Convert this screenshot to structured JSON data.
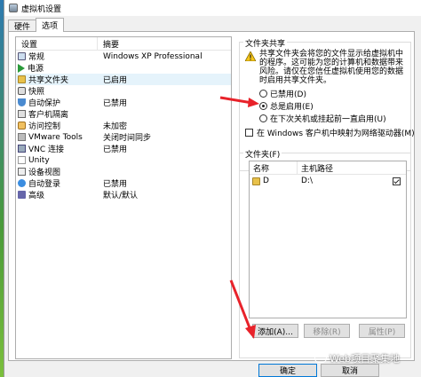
{
  "window": {
    "title": "虚拟机设置"
  },
  "tabs": [
    {
      "label": "硬件"
    },
    {
      "label": "选项"
    }
  ],
  "settings_list": {
    "headers": {
      "setting": "设置",
      "summary": "摘要"
    },
    "rows": [
      {
        "icon": "display-icon",
        "setting": "常规",
        "summary": "Windows XP Professional"
      },
      {
        "icon": "power-icon",
        "setting": "电源",
        "summary": ""
      },
      {
        "icon": "shared-folder-icon",
        "setting": "共享文件夹",
        "summary": "已启用"
      },
      {
        "icon": "snapshot-icon",
        "setting": "快照",
        "summary": ""
      },
      {
        "icon": "shield-icon",
        "setting": "自动保护",
        "summary": "已禁用"
      },
      {
        "icon": "guest-isolation-icon",
        "setting": "客户机隔离",
        "summary": ""
      },
      {
        "icon": "access-control-icon",
        "setting": "访问控制",
        "summary": "未加密"
      },
      {
        "icon": "vmware-tools-icon",
        "setting": "VMware Tools",
        "summary": "关闭时间同步"
      },
      {
        "icon": "vnc-icon",
        "setting": "VNC 连接",
        "summary": "已禁用"
      },
      {
        "icon": "unity-icon",
        "setting": "Unity",
        "summary": ""
      },
      {
        "icon": "appliance-view-icon",
        "setting": "设备视图",
        "summary": ""
      },
      {
        "icon": "autologin-icon",
        "setting": "自动登录",
        "summary": "已禁用"
      },
      {
        "icon": "advanced-icon",
        "setting": "高级",
        "summary": "默认/默认"
      }
    ]
  },
  "folder_sharing": {
    "title": "文件夹共享",
    "description": "共享文件夹会将您的文件显示给虚拟机中的程序。这可能为您的计算机和数据带来风险。请仅在您信任虚拟机使用您的数据时启用共享文件夹。",
    "options": [
      {
        "label": "已禁用(D)",
        "checked": false
      },
      {
        "label": "总是启用(E)",
        "checked": true
      },
      {
        "label": "在下次关机或挂起前一直启用(U)",
        "checked": false
      }
    ],
    "map_drive_label": "在 Windows 客户机中映射为网络驱动器(M)"
  },
  "folders": {
    "title": "文件夹(F)",
    "headers": {
      "name": "名称",
      "host_path": "主机路径"
    },
    "rows": [
      {
        "name": "D",
        "host_path": "D:\\",
        "enabled": true
      }
    ],
    "buttons": {
      "add": "添加(A)...",
      "remove": "移除(R)",
      "properties": "属性(P)"
    }
  },
  "dialog_buttons": {
    "ok": "确定",
    "cancel": "取消"
  },
  "watermark": {
    "text": "Web项目聚集地"
  },
  "colors": {
    "annotation_arrow": "#e8222a",
    "selection": "#e5f3fb",
    "focus_border": "#0078d7"
  }
}
